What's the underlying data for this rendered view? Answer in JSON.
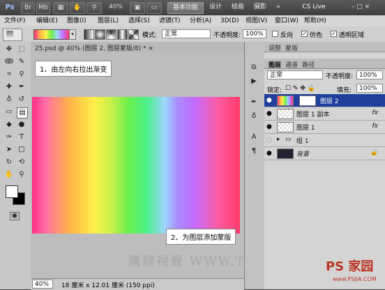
{
  "appbar": {
    "logo": "Ps",
    "br": "Br",
    "mb": "Mb",
    "zoom": "40%",
    "ws_basic": "基本功能",
    "ws_design": "设计",
    "ws_paint": "绘画",
    "ws_photo": "摄影",
    "more": "»",
    "cslive": "CS Live",
    "win_ctrl": "– □ ×"
  },
  "menu": [
    "文件(F)",
    "编辑(E)",
    "图像(I)",
    "图层(L)",
    "选择(S)",
    "滤镜(T)",
    "分析(A)",
    "3D(D)",
    "视图(V)",
    "窗口(W)",
    "帮助(H)"
  ],
  "options": {
    "mode_label": "模式:",
    "mode_value": "正常",
    "opacity_label": "不透明度:",
    "opacity_value": "100%",
    "reverse": "反向",
    "dither": "仿色",
    "transparency": "透明区域"
  },
  "document": {
    "tab": "25.psd @ 40% (图层 2, 图层蒙版/8) * ×",
    "zoom": "40%",
    "size": "18 厘米 x 12.01 厘米 (150 ppi)"
  },
  "callouts": {
    "step1": "1、由左向右拉出渐变",
    "step2": "2、为图层添加蒙版"
  },
  "watermark": "騰龍視覺 WWW.TLV",
  "site_logo": "PS 家园",
  "site_url": "www.PSJIA.COM",
  "panel": {
    "tabs_top": [
      "调整",
      "蒙版"
    ],
    "tabs": [
      "图层",
      "通道",
      "路径"
    ],
    "blend_mode": "正常",
    "opacity_label": "不透明度:",
    "opacity_value": "100%",
    "lock_label": "锁定:",
    "fill_label": "填充:",
    "fill_value": "100%",
    "layers": [
      {
        "name": "图层 2"
      },
      {
        "name": "图层 1 副本",
        "fx": "fx"
      },
      {
        "name": "图层 1",
        "fx": "fx"
      },
      {
        "name": "组 1"
      },
      {
        "name": "背景"
      }
    ]
  }
}
